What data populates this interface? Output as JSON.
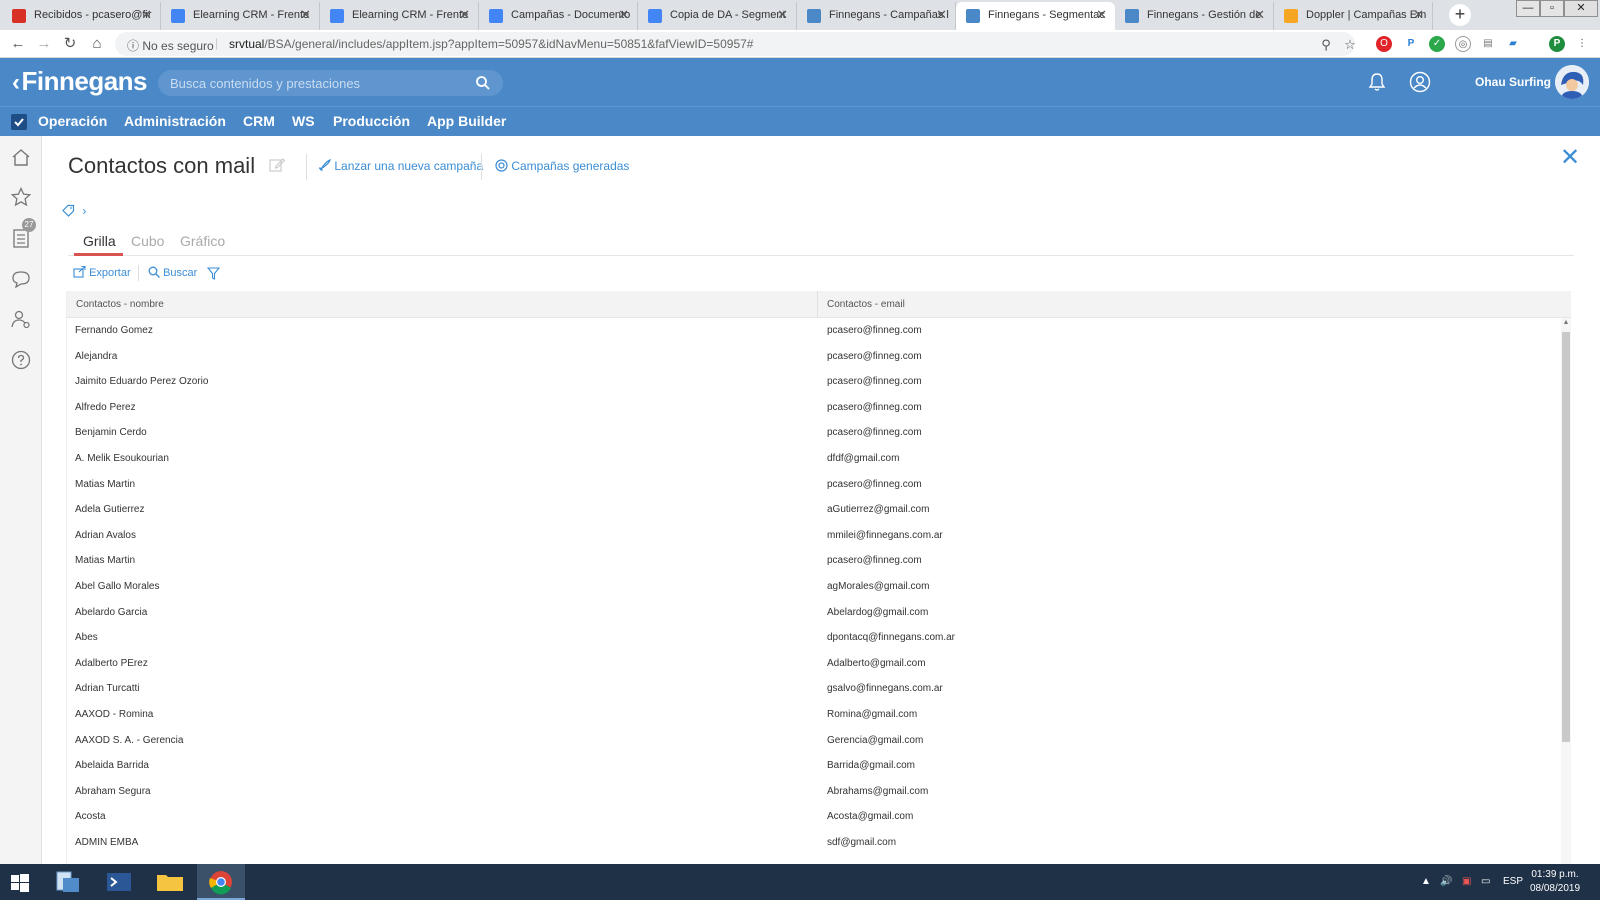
{
  "browser": {
    "tabs": [
      {
        "title": "Recibidos - pcasero@fir",
        "icon": "gmail-icon",
        "color": "#d93025"
      },
      {
        "title": "Elearning CRM - Frente",
        "icon": "docs-icon",
        "color": "#4285f4"
      },
      {
        "title": "Elearning CRM - Frente",
        "icon": "docs-icon",
        "color": "#4285f4"
      },
      {
        "title": "Campañas - Documento",
        "icon": "docs-icon",
        "color": "#4285f4"
      },
      {
        "title": "Copia de DA - Segment",
        "icon": "docs-icon",
        "color": "#4285f4"
      },
      {
        "title": "Finnegans - Campañas l",
        "icon": "finnegans-icon",
        "color": "#4a88c7"
      },
      {
        "title": "Finnegans - Segmentac",
        "icon": "finnegans-icon",
        "color": "#4a88c7",
        "active": true
      },
      {
        "title": "Finnegans - Gestión de",
        "icon": "finnegans-icon",
        "color": "#4a88c7"
      },
      {
        "title": "Doppler | Campañas Em",
        "icon": "doppler-icon",
        "color": "#f5a623"
      }
    ],
    "security_label": "No es seguro",
    "url_host": "srvtual",
    "url_path": "/BSA/general/includes/appItem.jsp?appItem=50957&idNavMenu=50851&fafViewID=50957#"
  },
  "app": {
    "logo": "Finnegans",
    "search_placeholder": "Busca contenidos y prestaciones",
    "user_name": "Ohau Surfing",
    "menu": [
      "Operación",
      "Administración",
      "CRM",
      "WS",
      "Producción",
      "App Builder"
    ],
    "sidebar_badge": "27"
  },
  "page": {
    "title": "Contactos con mail",
    "action_launch": "Lanzar una nueva campaña",
    "action_generated": "Campañas generadas",
    "crumb_separator": "›",
    "view_tabs": [
      "Grilla",
      "Cubo",
      "Gráfico"
    ],
    "export_label": "Exportar",
    "search_label": "Buscar"
  },
  "grid": {
    "columns": [
      "Contactos - nombre",
      "Contactos - email"
    ],
    "rows": [
      [
        "Fernando Gomez",
        "pcasero@finneg.com"
      ],
      [
        "Alejandra",
        "pcasero@finneg.com"
      ],
      [
        "Jaimito Eduardo Perez Ozorio",
        "pcasero@finneg.com"
      ],
      [
        "Alfredo Perez",
        "pcasero@finneg.com"
      ],
      [
        "Benjamin Cerdo",
        "pcasero@finneg.com"
      ],
      [
        "A. Melik Esoukourian",
        "dfdf@gmail.com"
      ],
      [
        "Matias Martin",
        "pcasero@finneg.com"
      ],
      [
        "Adela Gutierrez",
        "aGutierrez@gmail.com"
      ],
      [
        "Adrian Avalos",
        "mmilei@finnegans.com.ar"
      ],
      [
        "Matias Martin",
        "pcasero@finneg.com"
      ],
      [
        "Abel Gallo Morales",
        "agMorales@gmail.com"
      ],
      [
        "Abelardo Garcia",
        "Abelardog@gmail.com"
      ],
      [
        "Abes",
        "dpontacq@finnegans.com.ar"
      ],
      [
        "Adalberto PErez",
        "Adalberto@gmail.com"
      ],
      [
        "Adrian Turcatti",
        "gsalvo@finnegans.com.ar"
      ],
      [
        "AAXOD - Romina",
        "Romina@gmail.com"
      ],
      [
        "AAXOD S. A. - Gerencia",
        "Gerencia@gmail.com"
      ],
      [
        "Abelaida Barrida",
        "Barrida@gmail.com"
      ],
      [
        "Abraham Segura",
        "Abrahams@gmail.com"
      ],
      [
        "Acosta",
        "Acosta@gmail.com"
      ],
      [
        "ADMIN EMBA",
        "sdf@gmail.com"
      ]
    ]
  },
  "taskbar": {
    "language": "ESP",
    "time": "01:39 p.m.",
    "date": "08/08/2019"
  },
  "colors": {
    "brand_blue": "#4a88c7",
    "link_blue": "#3b8dd6",
    "active_tab_underline": "#d9534f"
  }
}
